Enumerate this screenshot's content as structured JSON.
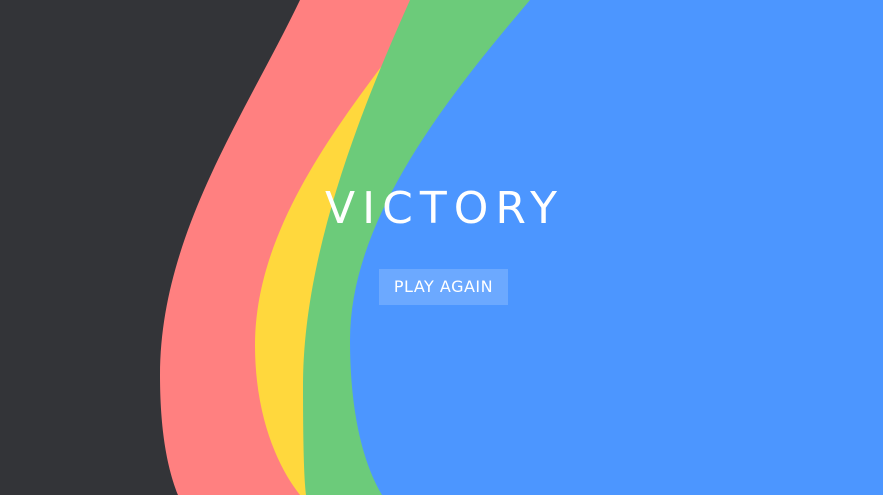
{
  "screen": {
    "title": "VICTORY",
    "play_again_label": "PLAY AGAIN"
  },
  "colors": {
    "background": "#333438",
    "red": "#ff8080",
    "yellow": "#ffd83d",
    "green": "#6ccb7a",
    "blue": "#4c96ff",
    "text": "#ffffff"
  }
}
